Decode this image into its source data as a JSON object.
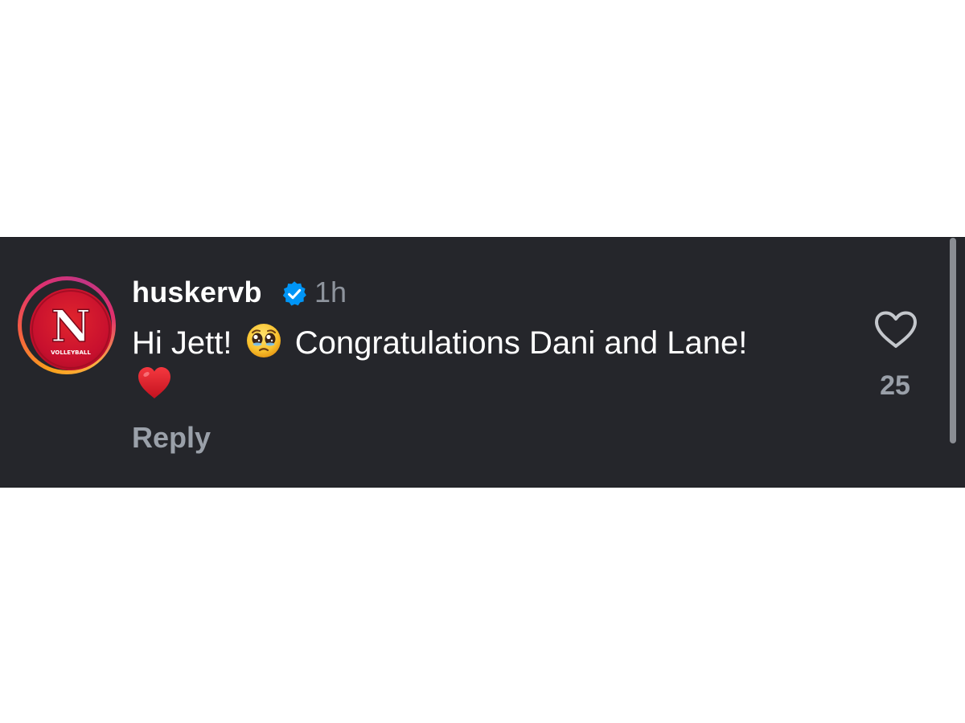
{
  "comment": {
    "username": "huskervb",
    "verified": true,
    "timestamp": "1h",
    "text_part1": "Hi Jett!",
    "text_part2": "Congratulations Dani and Lane!",
    "reply_label": "Reply",
    "like_count": "25"
  },
  "avatar": {
    "logo_letter": "N",
    "logo_caption": "VOLLEYBALL"
  },
  "icons": {
    "verified": "verified-badge-icon",
    "emoji_1": "pleading-face-emoji",
    "emoji_2": "red-heart-emoji",
    "like": "heart-outline-icon"
  },
  "colors": {
    "panel_bg": "#25262b",
    "username": "#ffffff",
    "muted_text": "#9aa0a9",
    "verified_blue": "#0095f6",
    "brand_red": "#c8102e"
  }
}
